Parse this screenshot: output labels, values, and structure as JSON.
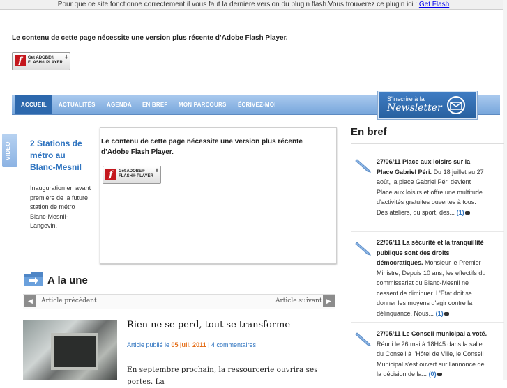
{
  "topbar": {
    "notice": "Pour que ce site fonctionne correctement il vous faut la derniere version du plugin flash.Vous trouverez ce plugin ici :",
    "link": "Get Flash"
  },
  "flash": {
    "message": "Le contenu de cette page nécessite une version plus récente d’Adobe Flash Player.",
    "badge_text": "Get ADOBE®\nFLASH® PLAYER"
  },
  "nav": {
    "items": [
      "ACCUEIL",
      "ACTUALITÉS",
      "AGENDA",
      "EN BREF",
      "MON PARCOURS",
      "ÉCRIVEZ-MOI"
    ]
  },
  "newsletter": {
    "small": "S'inscrire à la",
    "big": "Newsletter"
  },
  "video": {
    "tab_label": "VIDEO",
    "title": "2 Stations de métro au Blanc-Mesnil",
    "description": "Inauguration en avant première de la future station de métro Blanc-Mesnil-Langevin."
  },
  "alaune": {
    "title": "A la une",
    "prev": "Article précédent",
    "next": "Article suivant",
    "article": {
      "title": "Rien ne se perd, tout se transforme",
      "published_prefix": "Article publié le",
      "date": "05 juil. 2011",
      "separator": "|",
      "comments": "4 commentaires",
      "body": "En septembre prochain, la ressourcerie ouvrira ses portes. La"
    }
  },
  "enbref": {
    "title": "En bref",
    "items": [
      {
        "headline": "27/06/11 Place aux loisirs sur la Place Gabriel Péri.",
        "text": "Du 18 juillet au 27 août, la place Gabriel Péri devient Place aux loisirs et offre une multitude d'activités gratuites ouvertes à tous. Des ateliers, du sport, des...",
        "count": "(1)"
      },
      {
        "headline": "22/06/11 La sécurité et la tranquillité publique sont des droits démocratiques.",
        "text": "Monsieur le Premier Ministre, Depuis 10 ans, les effectifs du commissariat du Blanc-Mesnil ne cessent de diminuer. L'Etat doit se donner les moyens d'agir contre la délinquance. Nous...",
        "count": "(1)"
      },
      {
        "headline": "27/05/11 Le Conseil municipal a voté.",
        "text": "Réuni le 26 mai à 18H45 dans la salle du Conseil à l'Hôtel de Ville, le Conseil Municipal s'est ouvert sur l'annonce de la décision de la...",
        "count": "(0)"
      }
    ]
  },
  "colors": {
    "accent_blue": "#2f74c0",
    "nav_active": "#2d68ad",
    "date_orange": "#e46a12"
  }
}
